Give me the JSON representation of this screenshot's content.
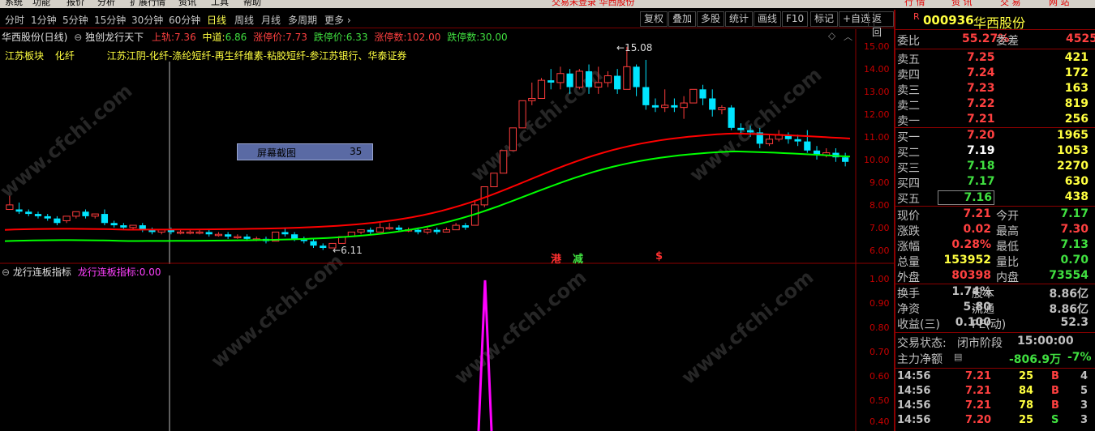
{
  "menu": {
    "items": [
      "系统",
      "功能",
      "报价",
      "分析",
      "扩展行情",
      "资讯",
      "工具",
      "帮助"
    ],
    "status": "交易未登录  华西股份",
    "right_tabs": [
      "行 情",
      "资 讯",
      "交 易",
      "网 站"
    ]
  },
  "toolbar": {
    "periods": [
      "分时",
      "1分钟",
      "5分钟",
      "15分钟",
      "30分钟",
      "60分钟",
      "日线",
      "周线",
      "月线",
      "多周期",
      "更多 ›"
    ],
    "active": "日线",
    "buttons": [
      "复权",
      "叠加",
      "多股",
      "统计",
      "画线",
      "F10",
      "标记",
      "+自选",
      "返回"
    ]
  },
  "main_header": {
    "title": "华西股份(日线)",
    "indicator": "独创龙行天下",
    "upper_label": "上轨:",
    "upper_val": "7.36",
    "mid_label": "中道:",
    "mid_val": "6.86",
    "limitup_label": "涨停价:",
    "limitup_val": "7.73",
    "limitdown_label": "跌停价:",
    "limitdown_val": "6.33",
    "upcount_label": "涨停数:",
    "upcount_val": "102.00",
    "downcount_label": "跌停数:",
    "downcount_val": "30.00"
  },
  "concept": {
    "sector": "江苏板块",
    "industry": "化纤",
    "desc": "江苏江阴-化纤-涤纶短纤-再生纤维素-粘胶短纤-参江苏银行、华泰证券"
  },
  "screenshot_box": {
    "label": "屏幕截图",
    "count": "35"
  },
  "annotations": {
    "high": "15.08",
    "low": "6.11",
    "marker1": "港",
    "marker2": "减",
    "marker3": "$"
  },
  "price_axis": [
    "15.00",
    "14.00",
    "13.00",
    "12.00",
    "11.00",
    "10.00",
    "9.00",
    "8.00",
    "7.00",
    "6.00"
  ],
  "sub_header": {
    "title": "龙行连板指标",
    "label": "龙行连板指标:",
    "val": "0.00"
  },
  "sub_axis": [
    "1.00",
    "0.90",
    "0.80",
    "0.70",
    "0.60",
    "0.50",
    "0.40"
  ],
  "quote": {
    "code": "000936",
    "name": "华西股份",
    "weibi_label": "委比",
    "weibi": "55.27%",
    "weicha_label": "委差",
    "weicha": "4525",
    "asks": [
      {
        "label": "卖五",
        "price": "7.25",
        "vol": "421"
      },
      {
        "label": "卖四",
        "price": "7.24",
        "vol": "172"
      },
      {
        "label": "卖三",
        "price": "7.23",
        "vol": "163"
      },
      {
        "label": "卖二",
        "price": "7.22",
        "vol": "819"
      },
      {
        "label": "卖一",
        "price": "7.21",
        "vol": "256"
      }
    ],
    "bids": [
      {
        "label": "买一",
        "price": "7.20",
        "vol": "1965"
      },
      {
        "label": "买二",
        "price": "7.19",
        "vol": "1053"
      },
      {
        "label": "买三",
        "price": "7.18",
        "vol": "2270"
      },
      {
        "label": "买四",
        "price": "7.17",
        "vol": "630"
      },
      {
        "label": "买五",
        "price": "7.16",
        "vol": "438"
      }
    ],
    "stats": [
      {
        "l1": "现价",
        "v1": "7.21",
        "l2": "今开",
        "v2": "7.17"
      },
      {
        "l1": "涨跌",
        "v1": "0.02",
        "l2": "最高",
        "v2": "7.30"
      },
      {
        "l1": "涨幅",
        "v1": "0.28%",
        "l2": "最低",
        "v2": "7.13"
      },
      {
        "l1": "总量",
        "v1": "153952",
        "l2": "量比",
        "v2": "0.70"
      },
      {
        "l1": "外盘",
        "v1": "80398",
        "l2": "内盘",
        "v2": "73554"
      }
    ],
    "stats2": [
      {
        "l1": "换手",
        "v1": "1.74%",
        "l2": "股本",
        "v2": "8.86亿"
      },
      {
        "l1": "净资",
        "v1": "5.80",
        "l2": "流通",
        "v2": "8.86亿"
      },
      {
        "l1": "收益(三)",
        "v1": "0.100",
        "l2": "PE(动)",
        "v2": "52.3"
      }
    ],
    "trade_status_label": "交易状态:",
    "trade_status": "闭市阶段",
    "trade_time": "15:00:00",
    "main_flow_label": "主力净额",
    "main_flow": "-806.9万",
    "main_flow_pct": "-7%",
    "ticks": [
      {
        "time": "14:56",
        "price": "7.21",
        "vol": "25",
        "side": "B",
        "n": "4"
      },
      {
        "time": "14:56",
        "price": "7.21",
        "vol": "84",
        "side": "B",
        "n": "5"
      },
      {
        "time": "14:56",
        "price": "7.21",
        "vol": "78",
        "side": "B",
        "n": "3"
      },
      {
        "time": "14:56",
        "price": "7.20",
        "vol": "25",
        "side": "S",
        "n": "3"
      }
    ]
  },
  "watermark": "www.cfchi.com",
  "colors": {
    "up": "#ff3c3c",
    "down": "#00e5ff",
    "upper_band": "#ff0000",
    "lower_band": "#00ff00",
    "indicator": "#ff00ff"
  },
  "chart_data": {
    "type": "candlestick",
    "price_range": [
      5.7,
      15.5
    ],
    "ohlc": [
      [
        7.9,
        8.5,
        8.1,
        7.9
      ],
      [
        7.9,
        8.2,
        7.8,
        7.7
      ],
      [
        7.8,
        7.9,
        7.7,
        7.6
      ],
      [
        7.7,
        7.8,
        7.6,
        7.5
      ],
      [
        7.6,
        7.7,
        7.5,
        7.4
      ],
      [
        7.5,
        7.6,
        7.3,
        7.2
      ],
      [
        7.4,
        7.6,
        7.6,
        7.3
      ],
      [
        7.6,
        7.8,
        7.8,
        7.5
      ],
      [
        7.8,
        7.9,
        7.6,
        7.5
      ],
      [
        7.6,
        7.7,
        7.7,
        7.5
      ],
      [
        7.7,
        7.9,
        7.3,
        7.2
      ],
      [
        7.3,
        7.4,
        7.2,
        7.1
      ],
      [
        7.2,
        7.3,
        7.1,
        7.0
      ],
      [
        7.1,
        7.2,
        7.2,
        7.0
      ],
      [
        7.2,
        7.3,
        7.0,
        6.9
      ],
      [
        7.0,
        7.1,
        6.9,
        6.8
      ],
      [
        6.9,
        7.0,
        7.0,
        6.8
      ],
      [
        7.0,
        7.1,
        6.9,
        6.8
      ],
      [
        6.9,
        7.0,
        6.9,
        6.8
      ],
      [
        6.9,
        7.0,
        6.9,
        6.8
      ],
      [
        6.9,
        7.0,
        6.9,
        6.8
      ],
      [
        6.9,
        7.0,
        6.8,
        6.7
      ],
      [
        6.8,
        6.9,
        6.8,
        6.7
      ],
      [
        6.8,
        6.9,
        6.7,
        6.6
      ],
      [
        6.7,
        6.8,
        6.7,
        6.6
      ],
      [
        6.7,
        6.8,
        6.6,
        6.5
      ],
      [
        6.6,
        6.7,
        6.6,
        6.5
      ],
      [
        6.6,
        6.7,
        6.5,
        6.4
      ],
      [
        6.5,
        6.6,
        6.9,
        6.5
      ],
      [
        6.9,
        7.1,
        6.8,
        6.7
      ],
      [
        6.8,
        6.9,
        6.6,
        6.5
      ],
      [
        6.6,
        6.7,
        6.5,
        6.4
      ],
      [
        6.5,
        6.6,
        6.3,
        6.2
      ],
      [
        6.3,
        6.4,
        6.2,
        6.11
      ],
      [
        6.2,
        6.3,
        6.4,
        6.2
      ],
      [
        6.4,
        6.6,
        6.7,
        6.4
      ],
      [
        6.7,
        6.9,
        6.9,
        6.7
      ],
      [
        6.9,
        7.0,
        7.0,
        6.8
      ],
      [
        7.0,
        7.1,
        6.9,
        6.8
      ],
      [
        6.9,
        7.3,
        7.1,
        6.9
      ],
      [
        7.1,
        7.3,
        7.1,
        7.0
      ],
      [
        7.1,
        7.2,
        7.0,
        6.9
      ],
      [
        7.0,
        7.1,
        7.0,
        6.9
      ],
      [
        7.0,
        7.1,
        6.9,
        6.8
      ],
      [
        6.9,
        7.1,
        7.0,
        6.8
      ],
      [
        7.0,
        7.1,
        6.9,
        6.8
      ],
      [
        6.9,
        7.1,
        7.0,
        6.9
      ],
      [
        7.0,
        7.3,
        7.2,
        7.0
      ],
      [
        7.2,
        7.3,
        7.1,
        7.0
      ],
      [
        7.2,
        8.3,
        8.1,
        7.2
      ],
      [
        8.1,
        8.8,
        8.9,
        8.0
      ],
      [
        8.9,
        9.5,
        9.5,
        8.9
      ],
      [
        9.5,
        10.5,
        10.5,
        9.5
      ],
      [
        10.5,
        11.5,
        11.5,
        10.5
      ],
      [
        11.5,
        12.7,
        12.7,
        11.5
      ],
      [
        12.7,
        13.5,
        12.8,
        12.5
      ],
      [
        12.8,
        13.7,
        13.6,
        12.8
      ],
      [
        13.6,
        14.1,
        13.5,
        13.2
      ],
      [
        13.5,
        14.2,
        13.9,
        13.2
      ],
      [
        13.9,
        14.1,
        13.3,
        13.0
      ],
      [
        13.3,
        14.1,
        14.0,
        13.2
      ],
      [
        14.0,
        14.3,
        13.3,
        13.0
      ],
      [
        13.3,
        14.2,
        13.5,
        13.0
      ],
      [
        13.5,
        14.0,
        13.8,
        13.3
      ],
      [
        13.8,
        14.1,
        13.2,
        13.0
      ],
      [
        13.2,
        15.08,
        14.2,
        13.2
      ],
      [
        14.2,
        14.3,
        13.3,
        12.9
      ],
      [
        13.3,
        14.5,
        12.5,
        12.3
      ],
      [
        12.5,
        12.8,
        12.4,
        12.2
      ],
      [
        12.4,
        13.2,
        12.5,
        12.2
      ],
      [
        12.5,
        12.8,
        12.4,
        12.2
      ],
      [
        12.4,
        12.9,
        12.6,
        11.9
      ],
      [
        12.6,
        13.0,
        13.2,
        12.6
      ],
      [
        13.2,
        13.4,
        12.8,
        12.5
      ],
      [
        12.8,
        13.2,
        12.3,
        12.0
      ],
      [
        12.3,
        12.5,
        12.4,
        12.1
      ],
      [
        12.4,
        12.5,
        11.5,
        11.4
      ],
      [
        11.5,
        11.7,
        11.4,
        11.2
      ],
      [
        11.4,
        11.6,
        11.3,
        11.1
      ],
      [
        11.3,
        11.5,
        10.8,
        10.6
      ],
      [
        10.8,
        11.2,
        11.0,
        10.7
      ],
      [
        11.0,
        11.4,
        11.2,
        10.9
      ],
      [
        11.2,
        11.3,
        11.0,
        10.8
      ],
      [
        11.0,
        11.2,
        10.9,
        10.7
      ],
      [
        10.9,
        11.4,
        10.5,
        10.4
      ],
      [
        10.5,
        10.7,
        10.3,
        10.1
      ],
      [
        10.3,
        10.6,
        10.4,
        10.2
      ],
      [
        10.4,
        10.6,
        10.2,
        10.0
      ],
      [
        10.2,
        10.4,
        10.0,
        9.8
      ]
    ],
    "upper_band_range": [
      7.0,
      11.4
    ],
    "mid_band_range": [
      6.5,
      10.6
    ],
    "indicator_peak": 1.0
  }
}
